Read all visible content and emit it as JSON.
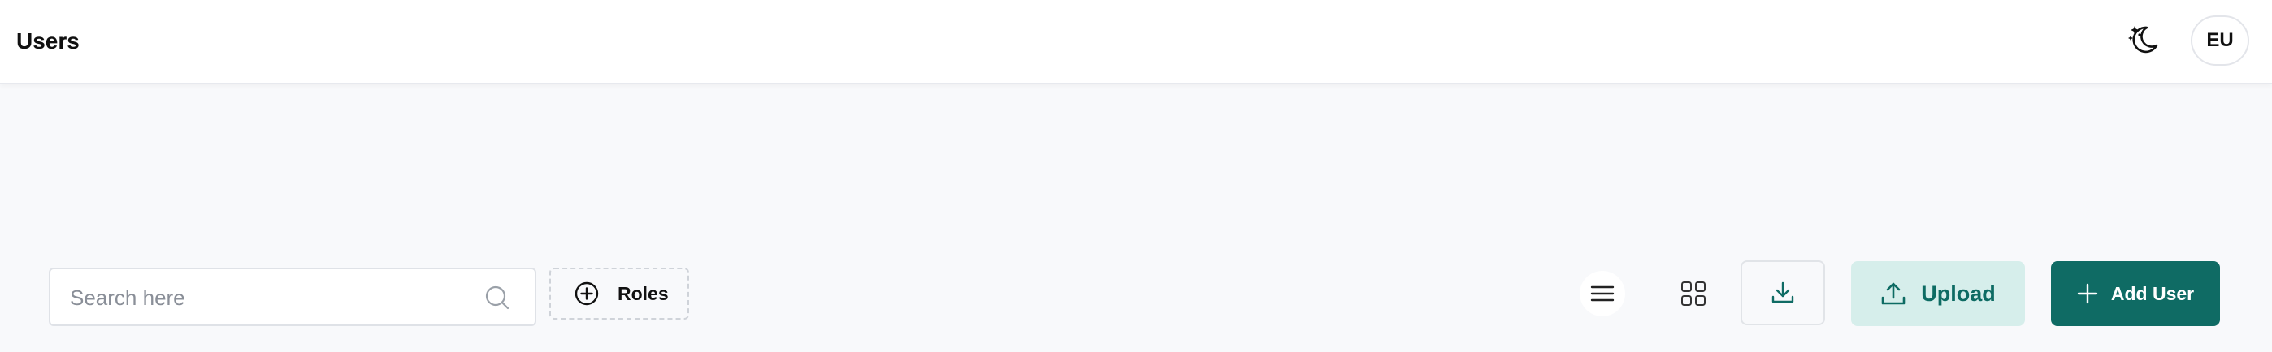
{
  "header": {
    "title": "Users",
    "avatar_initials": "EU",
    "theme_toggle_icon": "moon-stars-icon"
  },
  "toolbar": {
    "search": {
      "placeholder": "Search here",
      "value": "",
      "icon": "search-icon"
    },
    "roles_button": {
      "label": "Roles",
      "icon": "plus-circle-icon"
    },
    "view_buttons": [
      {
        "name": "list-view",
        "icon": "menu-lines-icon"
      },
      {
        "name": "grid-view",
        "icon": "grid-icon"
      }
    ],
    "download_button": {
      "icon": "download-icon"
    },
    "upload_button": {
      "label": "Upload",
      "icon": "upload-icon"
    },
    "add_user_button": {
      "label": "Add User",
      "icon": "plus-icon"
    }
  },
  "colors": {
    "accent": "#0f6b64",
    "accent_light": "#d6eeeb",
    "background": "#f8f9fb",
    "header_bg": "#ffffff"
  }
}
